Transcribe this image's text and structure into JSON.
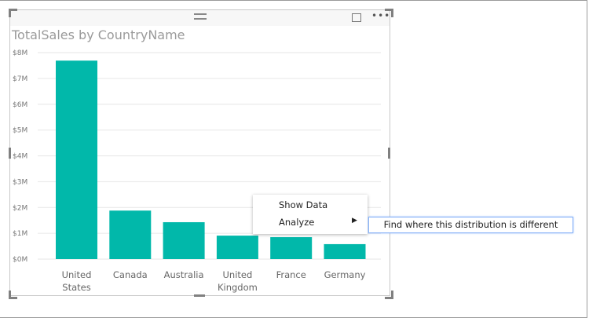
{
  "chart_data": {
    "type": "bar",
    "title": "TotalSales by CountryName",
    "xlabel": "",
    "ylabel": "",
    "categories": [
      "United States",
      "Canada",
      "Australia",
      "United Kingdom",
      "France",
      "Germany"
    ],
    "category_lines": [
      [
        "United",
        "States"
      ],
      [
        "Canada"
      ],
      [
        "Australia"
      ],
      [
        "United",
        "Kingdom"
      ],
      [
        "France"
      ],
      [
        "Germany"
      ]
    ],
    "values": [
      7.69,
      1.88,
      1.43,
      0.91,
      0.85,
      0.58
    ],
    "unit": "$M",
    "ylim": [
      0,
      8
    ],
    "yticks": [
      "$0M",
      "$1M",
      "$2M",
      "$3M",
      "$4M",
      "$5M",
      "$6M",
      "$7M",
      "$8M"
    ],
    "grid": true,
    "bar_color": "#01b8aa"
  },
  "context_menu": {
    "items": [
      "Show Data",
      "Analyze"
    ],
    "submenu_item": "Find where this distribution is different"
  }
}
